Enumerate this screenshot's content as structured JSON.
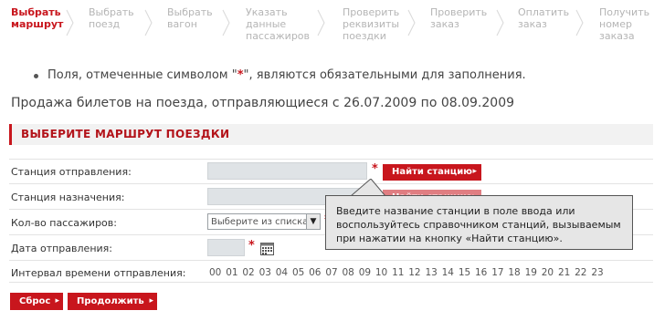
{
  "steps": [
    {
      "line1": "Выбрать",
      "line2": "маршрут",
      "line3": ""
    },
    {
      "line1": "Выбрать",
      "line2": "поезд",
      "line3": ""
    },
    {
      "line1": "Выбрать",
      "line2": "вагон",
      "line3": ""
    },
    {
      "line1": "Указать",
      "line2": "данные",
      "line3": "пассажиров"
    },
    {
      "line1": "Проверить",
      "line2": "реквизиты",
      "line3": "поездки"
    },
    {
      "line1": "Проверить",
      "line2": "заказ",
      "line3": ""
    },
    {
      "line1": "Оплатить",
      "line2": "заказ",
      "line3": ""
    },
    {
      "line1": "Получить",
      "line2": "номер",
      "line3": "заказа"
    }
  ],
  "note": {
    "before": "Поля, отмеченные символом \"",
    "star": "*",
    "after": "\", являются обязательными для заполнения."
  },
  "sale_info": "Продажа билетов на поезда, отправляющиеся с 26.07.2009 по 08.09.2009",
  "section_title": "ВЫБЕРИТЕ МАРШРУТ ПОЕЗДКИ",
  "form": {
    "departure_label": "Станция отправления:",
    "destination_label": "Станция назначения:",
    "passengers_label": "Кол-во пассажиров:",
    "date_label": "Дата отправления:",
    "interval_label": "Интервал времени отправления:",
    "find_station": "Найти станцию",
    "passengers_select": "Выберите из списка",
    "required_mark": "*",
    "hours": [
      "00",
      "01",
      "02",
      "03",
      "04",
      "05",
      "06",
      "07",
      "08",
      "09",
      "10",
      "11",
      "12",
      "13",
      "14",
      "15",
      "16",
      "17",
      "18",
      "19",
      "20",
      "21",
      "22",
      "23"
    ]
  },
  "tooltip": {
    "line1": "Введите название станции в поле ввода или",
    "line2": "воспользуйтесь справочником станций, вызываемым",
    "line3": "при нажатии на кнопку «Найти станцию»."
  },
  "buttons": {
    "reset": "Сброс",
    "continue": "Продолжить"
  },
  "colors": {
    "accent": "#c8161d",
    "field": "#dfe3e6",
    "tooltip_bg": "#e6e6e6"
  }
}
